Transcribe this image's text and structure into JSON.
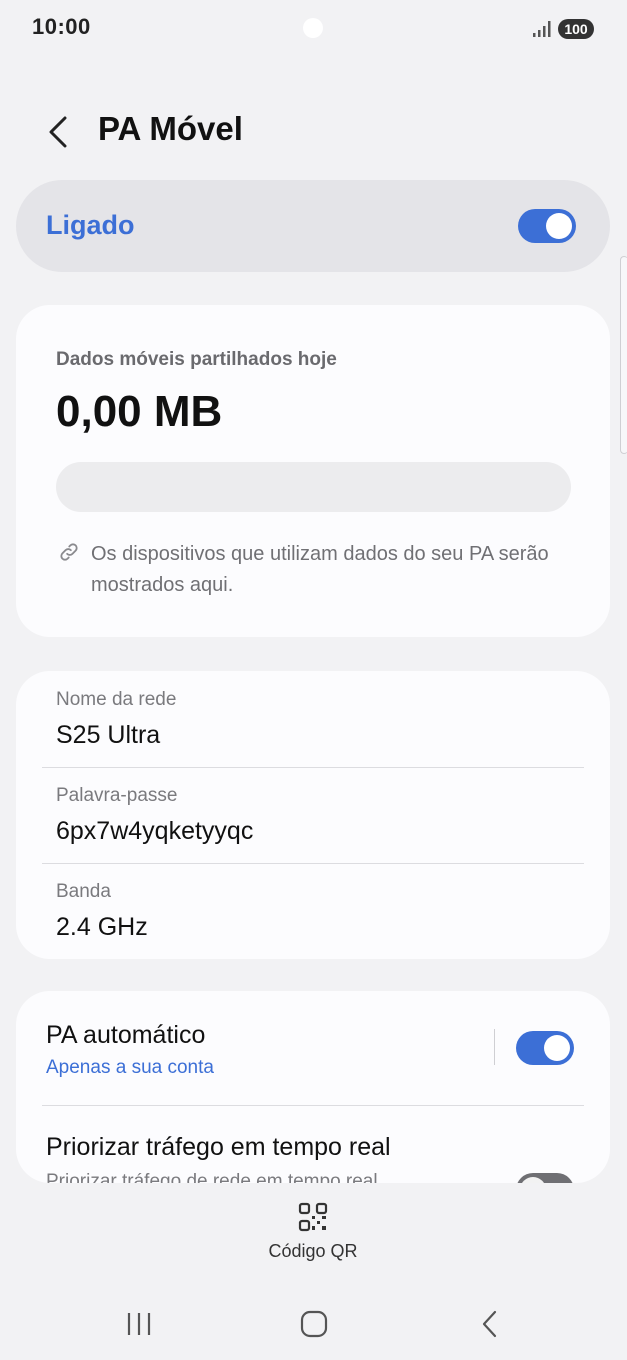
{
  "status_bar": {
    "time": "10:00",
    "battery": "100",
    "icons": [
      "signal-icon",
      "battery-icon"
    ]
  },
  "header": {
    "title": "PA Móvel",
    "back_icon": "chevron-left-icon"
  },
  "master_switch": {
    "label": "Ligado",
    "enabled": true
  },
  "usage": {
    "label": "Dados móveis partilhados hoje",
    "value": "0,00 MB",
    "progress": 0,
    "note_icon": "link-icon",
    "note": "Os dispositivos que utilizam dados do seu PA serão mostrados aqui."
  },
  "network": {
    "name_label": "Nome da rede",
    "name_value": "S25 Ultra",
    "password_label": "Palavra-passe",
    "password_value": "6px7w4yqketyyqc",
    "band_label": "Banda",
    "band_value": "2.4 GHz"
  },
  "auto_hotspot": {
    "title": "PA automático",
    "subtitle": "Apenas a sua conta",
    "enabled": true
  },
  "prioritize": {
    "title": "Priorizar tráfego em tempo real",
    "subtitle": "Priorizar tráfego de rede em tempo real",
    "enabled": false
  },
  "qr": {
    "label": "Código QR",
    "icon": "qr-code-icon"
  },
  "nav": {
    "icons": [
      "recent-apps-icon",
      "home-icon",
      "back-icon"
    ]
  },
  "colors": {
    "accent": "#3c6fd6",
    "background": "#f2f2f4",
    "card": "#fcfcfe"
  }
}
